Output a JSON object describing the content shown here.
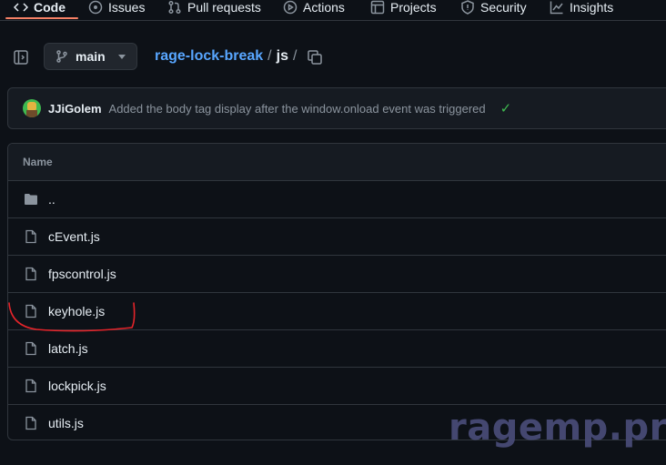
{
  "nav": {
    "tabs": [
      {
        "label": "Code",
        "icon": "code-icon",
        "active": true
      },
      {
        "label": "Issues",
        "icon": "issue-icon"
      },
      {
        "label": "Pull requests",
        "icon": "pull-request-icon"
      },
      {
        "label": "Actions",
        "icon": "play-icon"
      },
      {
        "label": "Projects",
        "icon": "table-icon"
      },
      {
        "label": "Security",
        "icon": "shield-icon"
      },
      {
        "label": "Insights",
        "icon": "graph-icon"
      }
    ],
    "accent_color": "#f78166"
  },
  "breadcrumb": {
    "branch": "main",
    "repo": "rage-lock-break",
    "sep": "/",
    "current": "js"
  },
  "commit": {
    "author": "JJiGolem",
    "message": "Added the body tag display after the window.onload event was triggered",
    "status": "✓",
    "status_color": "#3fb950"
  },
  "table": {
    "header": "Name",
    "rows": [
      {
        "name": "..",
        "type": "folder",
        "icon": "folder-icon"
      },
      {
        "name": "cEvent.js",
        "type": "file",
        "icon": "file-icon"
      },
      {
        "name": "fpscontrol.js",
        "type": "file",
        "icon": "file-icon"
      },
      {
        "name": "keyhole.js",
        "type": "file",
        "icon": "file-icon"
      },
      {
        "name": "latch.js",
        "type": "file",
        "icon": "file-icon"
      },
      {
        "name": "lockpick.js",
        "type": "file",
        "icon": "file-icon"
      },
      {
        "name": "utils.js",
        "type": "file",
        "icon": "file-icon"
      }
    ]
  },
  "annotation": {
    "color": "#e5242a",
    "highlighted_row": "keyhole.js"
  },
  "watermark": "ragemp.pro",
  "colors": {
    "background": "#0d1117",
    "link": "#58a6ff",
    "border": "#30363d"
  }
}
